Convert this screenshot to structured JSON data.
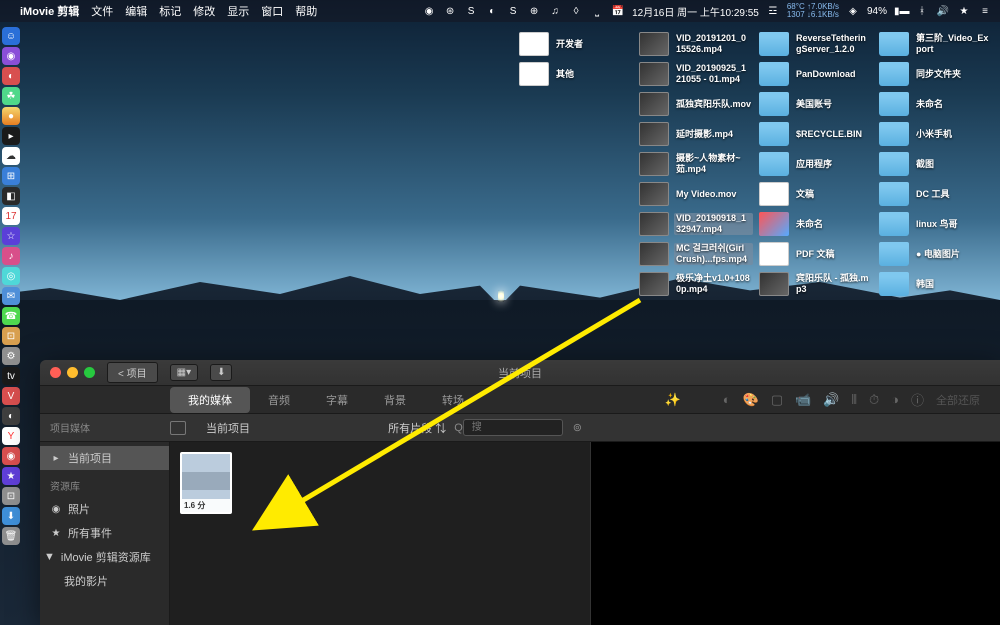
{
  "menubar": {
    "app": "iMovie 剪辑",
    "items": [
      "文件",
      "编辑",
      "标记",
      "修改",
      "显示",
      "窗口",
      "帮助"
    ],
    "datetime": "12月16日 周一 上午10:29:55",
    "temp": "68°C",
    "cpu": "1307",
    "up": "↑7.0KB/s",
    "down": "↓6.1KB/s",
    "battery": "94%"
  },
  "desktop": {
    "col1": [
      {
        "t": "doc",
        "l": "开发者"
      },
      {
        "t": "doc",
        "l": "其他"
      }
    ],
    "col2": [
      {
        "t": "video",
        "l": "VID_20191201_015526.mp4"
      },
      {
        "t": "video",
        "l": "VID_20190925_121055 - 01.mp4"
      },
      {
        "t": "video",
        "l": "孤独宾阳乐队.mov"
      },
      {
        "t": "video",
        "l": "延时摄影.mp4"
      },
      {
        "t": "video",
        "l": "摄影~人物素材~茹.mp4"
      },
      {
        "t": "video",
        "l": "My Video.mov"
      },
      {
        "t": "video",
        "l": "VID_20190918_132947.mp4",
        "sel": true
      },
      {
        "t": "video",
        "l": "MC 걸크러쉬(Girl Crush)...fps.mp4",
        "sel": true
      },
      {
        "t": "video",
        "l": "极乐净土v1.0+1080p.mp4"
      }
    ],
    "col3": [
      {
        "t": "folder",
        "l": "ReverseTetheringServer_1.2.0"
      },
      {
        "t": "folder",
        "l": "PanDownload"
      },
      {
        "t": "folder",
        "l": "美国账号"
      },
      {
        "t": "folder",
        "l": "$RECYCLE.BIN"
      },
      {
        "t": "folder",
        "l": "应用程序"
      },
      {
        "t": "doc",
        "l": "文稿"
      },
      {
        "t": "app",
        "l": "未命名"
      },
      {
        "t": "doc",
        "l": "PDF 文稿"
      },
      {
        "t": "video",
        "l": "宾阳乐队 - 孤独.mp3"
      }
    ],
    "col4": [
      {
        "t": "folder",
        "l": "第三阶_Video_Export"
      },
      {
        "t": "folder",
        "l": "同步文件夹"
      },
      {
        "t": "folder",
        "l": "未命名"
      },
      {
        "t": "folder",
        "l": "小米手机"
      },
      {
        "t": "folder",
        "l": "截图"
      },
      {
        "t": "folder",
        "l": "DC 工具"
      },
      {
        "t": "folder",
        "l": "linux 鸟哥"
      },
      {
        "t": "folder",
        "l": "● 电脑图片"
      },
      {
        "t": "folder",
        "l": "韩国"
      }
    ]
  },
  "imovie": {
    "title": "当前项目",
    "backBtn": "项目",
    "tabs": [
      "我的媒体",
      "音频",
      "字幕",
      "背景",
      "转场"
    ],
    "activeTab": 0,
    "rightTool": "全部还原",
    "row2": {
      "sidebarHdr": "项目媒体",
      "currentProj": "当前项目",
      "filter": "所有片段",
      "searchIcon": "Q",
      "searchPh": "搜"
    },
    "sidebar": {
      "currentProj": "当前项目",
      "libHdr": "资源库",
      "photos": "照片",
      "allEvents": "所有事件",
      "editLib": "iMovie 剪辑资源库",
      "myMovies": "我的影片"
    },
    "clip": {
      "duration": "1.6 分"
    }
  }
}
